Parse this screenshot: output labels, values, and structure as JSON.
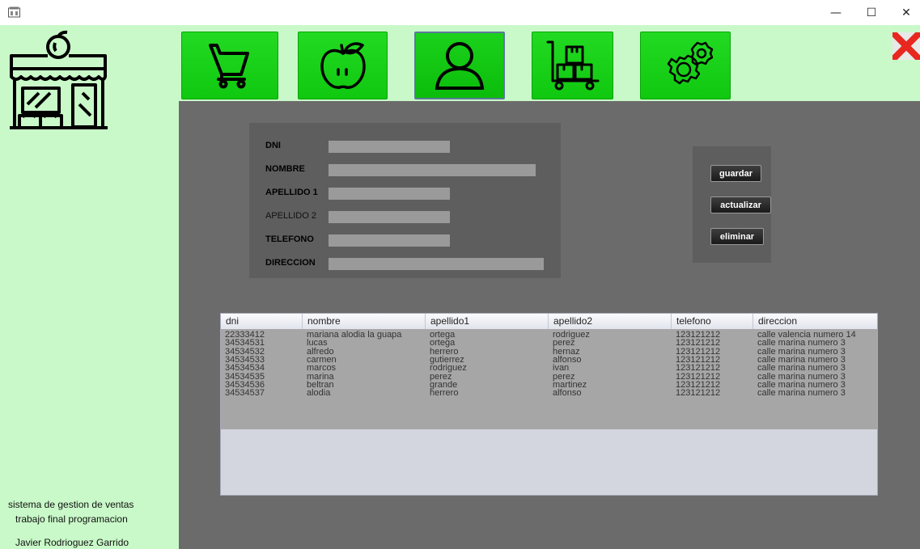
{
  "window": {
    "minimize_glyph": "—",
    "maximize_glyph": "☐",
    "close_glyph": "✕"
  },
  "nav": {
    "buttons": [
      {
        "icon": "cart-icon",
        "active": false
      },
      {
        "icon": "apple-icon",
        "active": false
      },
      {
        "icon": "user-icon",
        "active": true
      },
      {
        "icon": "boxes-cart-icon",
        "active": false
      },
      {
        "icon": "gears-icon",
        "active": false
      }
    ],
    "close_icon": "red-x-icon"
  },
  "form": {
    "fields": [
      {
        "label": "DNI",
        "value": ""
      },
      {
        "label": "NOMBRE",
        "value": ""
      },
      {
        "label": "APELLIDO 1",
        "value": ""
      },
      {
        "label": "APELLIDO 2",
        "value": ""
      },
      {
        "label": "TELEFONO",
        "value": ""
      },
      {
        "label": "DIRECCION",
        "value": ""
      }
    ]
  },
  "actions": {
    "save": "guardar",
    "update": "actualizar",
    "delete": "eliminar"
  },
  "table": {
    "columns": [
      "dni",
      "nombre",
      "apellido1",
      "apellido2",
      "telefono",
      "direccion"
    ],
    "rows": [
      [
        "22333412",
        "mariana alodia la guapa",
        "ortega",
        "rodriguez",
        "123121212",
        "calle valencia numero 14"
      ],
      [
        "34534531",
        "lucas",
        "ortega",
        "perez",
        "123121212",
        "calle marina numero 3"
      ],
      [
        "34534532",
        "alfredo",
        "herrero",
        "hernaz",
        "123121212",
        "calle marina numero 3"
      ],
      [
        "34534533",
        "carmen",
        "gutierrez",
        "alfonso",
        "123121212",
        "calle marina numero 3"
      ],
      [
        "34534534",
        "marcos",
        "rodriguez",
        "ivan",
        "123121212",
        "calle marina numero 3"
      ],
      [
        "34534535",
        "marina",
        "perez",
        "perez",
        "123121212",
        "calle marina numero 3"
      ],
      [
        "34534536",
        "beltran",
        "grande",
        "martinez",
        "123121212",
        "calle marina numero 3"
      ],
      [
        "34534537",
        "alodia",
        "herrero",
        "alfonso",
        "123121212",
        "calle marina numero 3"
      ]
    ]
  },
  "footer": {
    "line1": "sistema de gestion de ventas",
    "line2": "trabajo final programacion",
    "line3": "Javier Rodrioguez Garrido"
  },
  "colors": {
    "sidebar": "#c9f9c9",
    "nav_green": "#15cc15",
    "main_gray": "#6b6b6b",
    "close_red": "#e8271f"
  }
}
